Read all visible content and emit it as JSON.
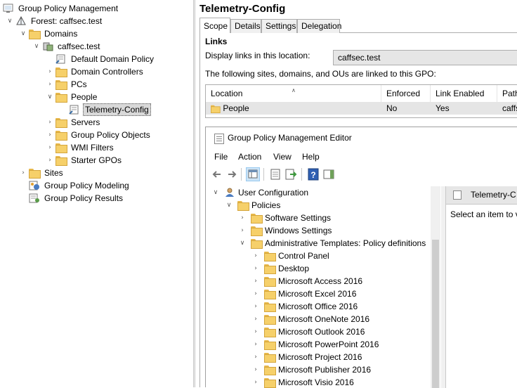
{
  "gpmc_tree": {
    "items": [
      {
        "label": "Group Policy Management",
        "chevron": "",
        "icon": "gpmc-console-icon"
      },
      {
        "label": "Forest: caffsec.test",
        "chevron": "v",
        "icon": "forest-icon"
      },
      {
        "label": "Domains",
        "chevron": "v",
        "icon": "domains-folder-icon"
      },
      {
        "label": "caffsec.test",
        "chevron": "v",
        "icon": "domain-icon"
      },
      {
        "label": "Default Domain Policy",
        "chevron": "",
        "icon": "gpo-link-icon"
      },
      {
        "label": "Domain Controllers",
        "chevron": ">",
        "icon": "ou-folder-icon"
      },
      {
        "label": "PCs",
        "chevron": ">",
        "icon": "ou-folder-icon"
      },
      {
        "label": "People",
        "chevron": "v",
        "icon": "ou-folder-icon"
      },
      {
        "label": "Telemetry-Config",
        "chevron": "",
        "icon": "gpo-link-icon"
      },
      {
        "label": "Servers",
        "chevron": ">",
        "icon": "ou-folder-icon"
      },
      {
        "label": "Group Policy Objects",
        "chevron": ">",
        "icon": "folder-icon"
      },
      {
        "label": "WMI Filters",
        "chevron": ">",
        "icon": "folder-icon"
      },
      {
        "label": "Starter GPOs",
        "chevron": ">",
        "icon": "folder-icon"
      },
      {
        "label": "Sites",
        "chevron": ">",
        "icon": "sites-icon"
      },
      {
        "label": "Group Policy Modeling",
        "chevron": "",
        "icon": "modeling-icon"
      },
      {
        "label": "Group Policy Results",
        "chevron": "",
        "icon": "results-icon"
      }
    ]
  },
  "gpo": {
    "title": "Telemetry-Config",
    "tabs": [
      "Scope",
      "Details",
      "Settings",
      "Delegation"
    ],
    "links_heading": "Links",
    "display_links_label": "Display links in this location:",
    "display_links_value": "caffsec.test",
    "linked_description": "The following sites, domains, and OUs are linked to this GPO:",
    "links_table": {
      "headers": [
        "Location",
        "Enforced",
        "Link Enabled",
        "Path"
      ],
      "row": {
        "location": "People",
        "enforced": "No",
        "link_enabled": "Yes",
        "path": "caffs"
      }
    }
  },
  "editor": {
    "title": "Group Policy Management Editor",
    "menu": [
      "File",
      "Action",
      "View",
      "Help"
    ],
    "tree": [
      {
        "label": "User Configuration",
        "chevron": "v"
      },
      {
        "label": "Policies",
        "chevron": "v"
      },
      {
        "label": "Software Settings",
        "chevron": ">"
      },
      {
        "label": "Windows Settings",
        "chevron": ">"
      },
      {
        "label": "Administrative Templates: Policy definitions",
        "chevron": "v"
      },
      {
        "label": "Control Panel",
        "chevron": ">"
      },
      {
        "label": "Desktop",
        "chevron": ">"
      },
      {
        "label": "Microsoft Access 2016",
        "chevron": ">"
      },
      {
        "label": "Microsoft Excel 2016",
        "chevron": ">"
      },
      {
        "label": "Microsoft Office 2016",
        "chevron": ">"
      },
      {
        "label": "Microsoft OneNote 2016",
        "chevron": ">"
      },
      {
        "label": "Microsoft Outlook 2016",
        "chevron": ">"
      },
      {
        "label": "Microsoft PowerPoint 2016",
        "chevron": ">"
      },
      {
        "label": "Microsoft Project 2016",
        "chevron": ">"
      },
      {
        "label": "Microsoft Publisher 2016",
        "chevron": ">"
      },
      {
        "label": "Microsoft Visio 2016",
        "chevron": ">"
      }
    ],
    "right_header": "Telemetry-C",
    "right_hint": "Select an item to v"
  }
}
